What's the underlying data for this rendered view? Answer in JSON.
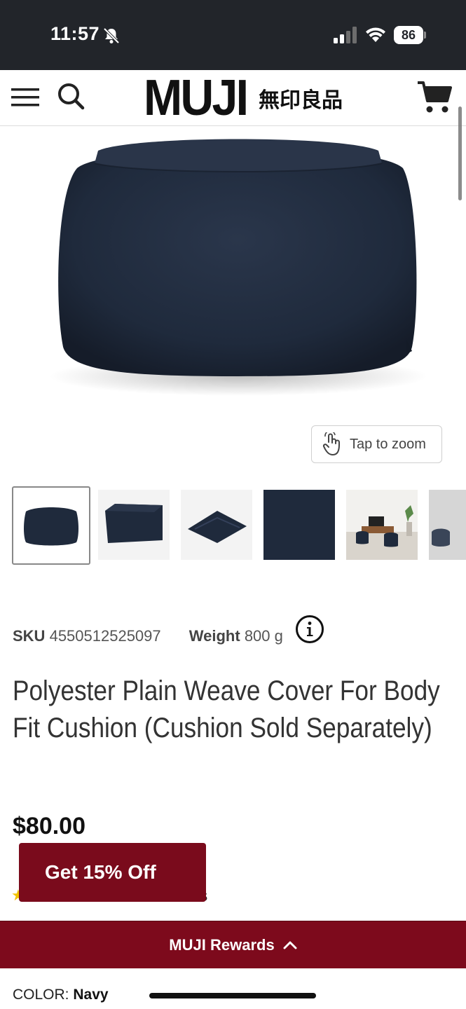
{
  "status_bar": {
    "time": "11:57",
    "battery": "86",
    "icons": [
      "bell-slash-icon",
      "signal-icon",
      "wifi-icon",
      "battery-icon"
    ]
  },
  "header": {
    "logo_text": "MUJI",
    "logo_cjk": "無印良品",
    "icons": [
      "menu-icon",
      "search-icon",
      "cart-icon"
    ]
  },
  "gallery": {
    "zoom_label": "Tap to zoom",
    "thumbnail_count": 6
  },
  "product": {
    "sku_label": "SKU",
    "sku_value": "4550512525097",
    "weight_label": "Weight",
    "weight_value": "800 g",
    "title": "Polyester Plain Weave Cover For Body Fit Cushion (Cushion Sold Separately)",
    "price": "$80.00",
    "reviews_fragment": "s",
    "color_label": "COLOR: ",
    "color_value": "Navy"
  },
  "promo": {
    "label": "Get 15% Off"
  },
  "rewards": {
    "label": "MUJI Rewards"
  },
  "colors": {
    "brand_red": "#7d0a1c",
    "status_bar": "#22252a",
    "navy_fabric": "#1f2a3c",
    "star": "#f2c200"
  }
}
